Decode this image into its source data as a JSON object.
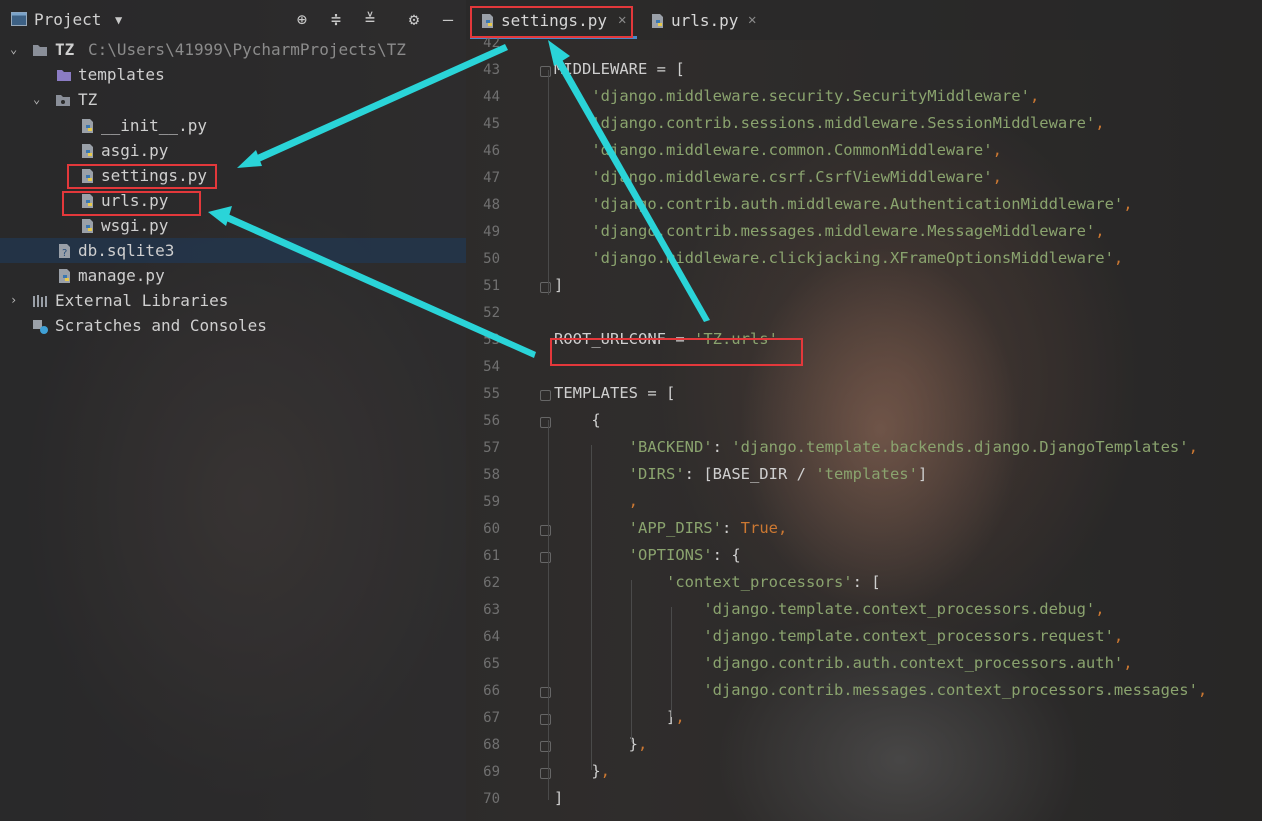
{
  "sidebar": {
    "title": "Project",
    "tree": [
      {
        "label": "TZ",
        "path": "C:\\Users\\41999\\PycharmProjects\\TZ"
      },
      {
        "label": "templates"
      },
      {
        "label": "TZ"
      },
      {
        "label": "__init__.py"
      },
      {
        "label": "asgi.py"
      },
      {
        "label": "settings.py"
      },
      {
        "label": "urls.py"
      },
      {
        "label": "wsgi.py"
      },
      {
        "label": "db.sqlite3"
      },
      {
        "label": "manage.py"
      },
      {
        "label": "External Libraries"
      },
      {
        "label": "Scratches and Consoles"
      }
    ]
  },
  "tabs": [
    {
      "label": "settings.py",
      "active": true
    },
    {
      "label": "urls.py",
      "active": false
    }
  ],
  "editor": {
    "line_numbers": [
      "42",
      "43",
      "44",
      "45",
      "46",
      "47",
      "48",
      "49",
      "50",
      "51",
      "52",
      "53",
      "54",
      "55",
      "56",
      "57",
      "58",
      "59",
      "60",
      "61",
      "62",
      "63",
      "64",
      "65",
      "66",
      "67",
      "68",
      "69",
      "70"
    ],
    "lines": [
      [],
      [
        {
          "t": "MIDDLEWARE = [",
          "c": "p"
        }
      ],
      [
        {
          "t": "    ",
          "c": "p"
        },
        {
          "t": "'django.middleware.security.SecurityMiddleware'",
          "c": "s"
        },
        {
          "t": ",",
          "c": "k"
        }
      ],
      [
        {
          "t": "    ",
          "c": "p"
        },
        {
          "t": "'django.contrib.sessions.middleware.SessionMiddleware'",
          "c": "s"
        },
        {
          "t": ",",
          "c": "k"
        }
      ],
      [
        {
          "t": "    ",
          "c": "p"
        },
        {
          "t": "'django.middleware.common.CommonMiddleware'",
          "c": "s"
        },
        {
          "t": ",",
          "c": "k"
        }
      ],
      [
        {
          "t": "    ",
          "c": "p"
        },
        {
          "t": "'django.middleware.csrf.CsrfViewMiddleware'",
          "c": "s"
        },
        {
          "t": ",",
          "c": "k"
        }
      ],
      [
        {
          "t": "    ",
          "c": "p"
        },
        {
          "t": "'django.contrib.auth.middleware.AuthenticationMiddleware'",
          "c": "s"
        },
        {
          "t": ",",
          "c": "k"
        }
      ],
      [
        {
          "t": "    ",
          "c": "p"
        },
        {
          "t": "'django.contrib.messages.middleware.MessageMiddleware'",
          "c": "s"
        },
        {
          "t": ",",
          "c": "k"
        }
      ],
      [
        {
          "t": "    ",
          "c": "p"
        },
        {
          "t": "'django.middleware.clickjacking.XFrameOptionsMiddleware'",
          "c": "s"
        },
        {
          "t": ",",
          "c": "k"
        }
      ],
      [
        {
          "t": "]",
          "c": "p"
        }
      ],
      [],
      [
        {
          "t": "ROOT_URLCONF = ",
          "c": "p"
        },
        {
          "t": "'TZ.urls'",
          "c": "s"
        }
      ],
      [],
      [
        {
          "t": "TEMPLATES = [",
          "c": "p"
        }
      ],
      [
        {
          "t": "    {",
          "c": "p"
        }
      ],
      [
        {
          "t": "        ",
          "c": "p"
        },
        {
          "t": "'BACKEND'",
          "c": "s"
        },
        {
          "t": ": ",
          "c": "p"
        },
        {
          "t": "'django.template.backends.django.DjangoTemplates'",
          "c": "s"
        },
        {
          "t": ",",
          "c": "k"
        }
      ],
      [
        {
          "t": "        ",
          "c": "p"
        },
        {
          "t": "'DIRS'",
          "c": "s"
        },
        {
          "t": ": [BASE_DIR / ",
          "c": "p"
        },
        {
          "t": "'templates'",
          "c": "s"
        },
        {
          "t": "]",
          "c": "p"
        }
      ],
      [
        {
          "t": "        ",
          "c": "p"
        },
        {
          "t": ",",
          "c": "k"
        }
      ],
      [
        {
          "t": "        ",
          "c": "p"
        },
        {
          "t": "'APP_DIRS'",
          "c": "s"
        },
        {
          "t": ": ",
          "c": "p"
        },
        {
          "t": "True",
          "c": "k"
        },
        {
          "t": ",",
          "c": "k"
        }
      ],
      [
        {
          "t": "        ",
          "c": "p"
        },
        {
          "t": "'OPTIONS'",
          "c": "s"
        },
        {
          "t": ": {",
          "c": "p"
        }
      ],
      [
        {
          "t": "            ",
          "c": "p"
        },
        {
          "t": "'context_processors'",
          "c": "s"
        },
        {
          "t": ": [",
          "c": "p"
        }
      ],
      [
        {
          "t": "                ",
          "c": "p"
        },
        {
          "t": "'django.template.context_processors.debug'",
          "c": "s"
        },
        {
          "t": ",",
          "c": "k"
        }
      ],
      [
        {
          "t": "                ",
          "c": "p"
        },
        {
          "t": "'django.template.context_processors.request'",
          "c": "s"
        },
        {
          "t": ",",
          "c": "k"
        }
      ],
      [
        {
          "t": "                ",
          "c": "p"
        },
        {
          "t": "'django.contrib.auth.context_processors.auth'",
          "c": "s"
        },
        {
          "t": ",",
          "c": "k"
        }
      ],
      [
        {
          "t": "                ",
          "c": "p"
        },
        {
          "t": "'django.contrib.messages.context_processors.messages'",
          "c": "s"
        },
        {
          "t": ",",
          "c": "k"
        }
      ],
      [
        {
          "t": "            ",
          "c": "p"
        },
        {
          "t": "]",
          "c": "p"
        },
        {
          "t": ",",
          "c": "k"
        }
      ],
      [
        {
          "t": "        ",
          "c": "p"
        },
        {
          "t": "}",
          "c": "p"
        },
        {
          "t": ",",
          "c": "k"
        }
      ],
      [
        {
          "t": "    ",
          "c": "p"
        },
        {
          "t": "}",
          "c": "p"
        },
        {
          "t": ",",
          "c": "k"
        }
      ],
      [
        {
          "t": "]",
          "c": "p"
        }
      ]
    ]
  },
  "colors": {
    "annotation_box": "#e3383b",
    "annotation_arrow": "#2ad4d8",
    "string": "#8aa36e",
    "keyword": "#cc7832",
    "selection": "#213750",
    "tab_underline": "#4a88c7"
  },
  "icons": [
    "project-window-icon",
    "chevron-down-icon",
    "locate-icon",
    "expand-all-icon",
    "collapse-all-icon",
    "gear-icon",
    "minimize-icon",
    "folder-icon",
    "python-file-icon",
    "database-file-icon",
    "library-icon",
    "scratches-icon",
    "close-icon"
  ]
}
